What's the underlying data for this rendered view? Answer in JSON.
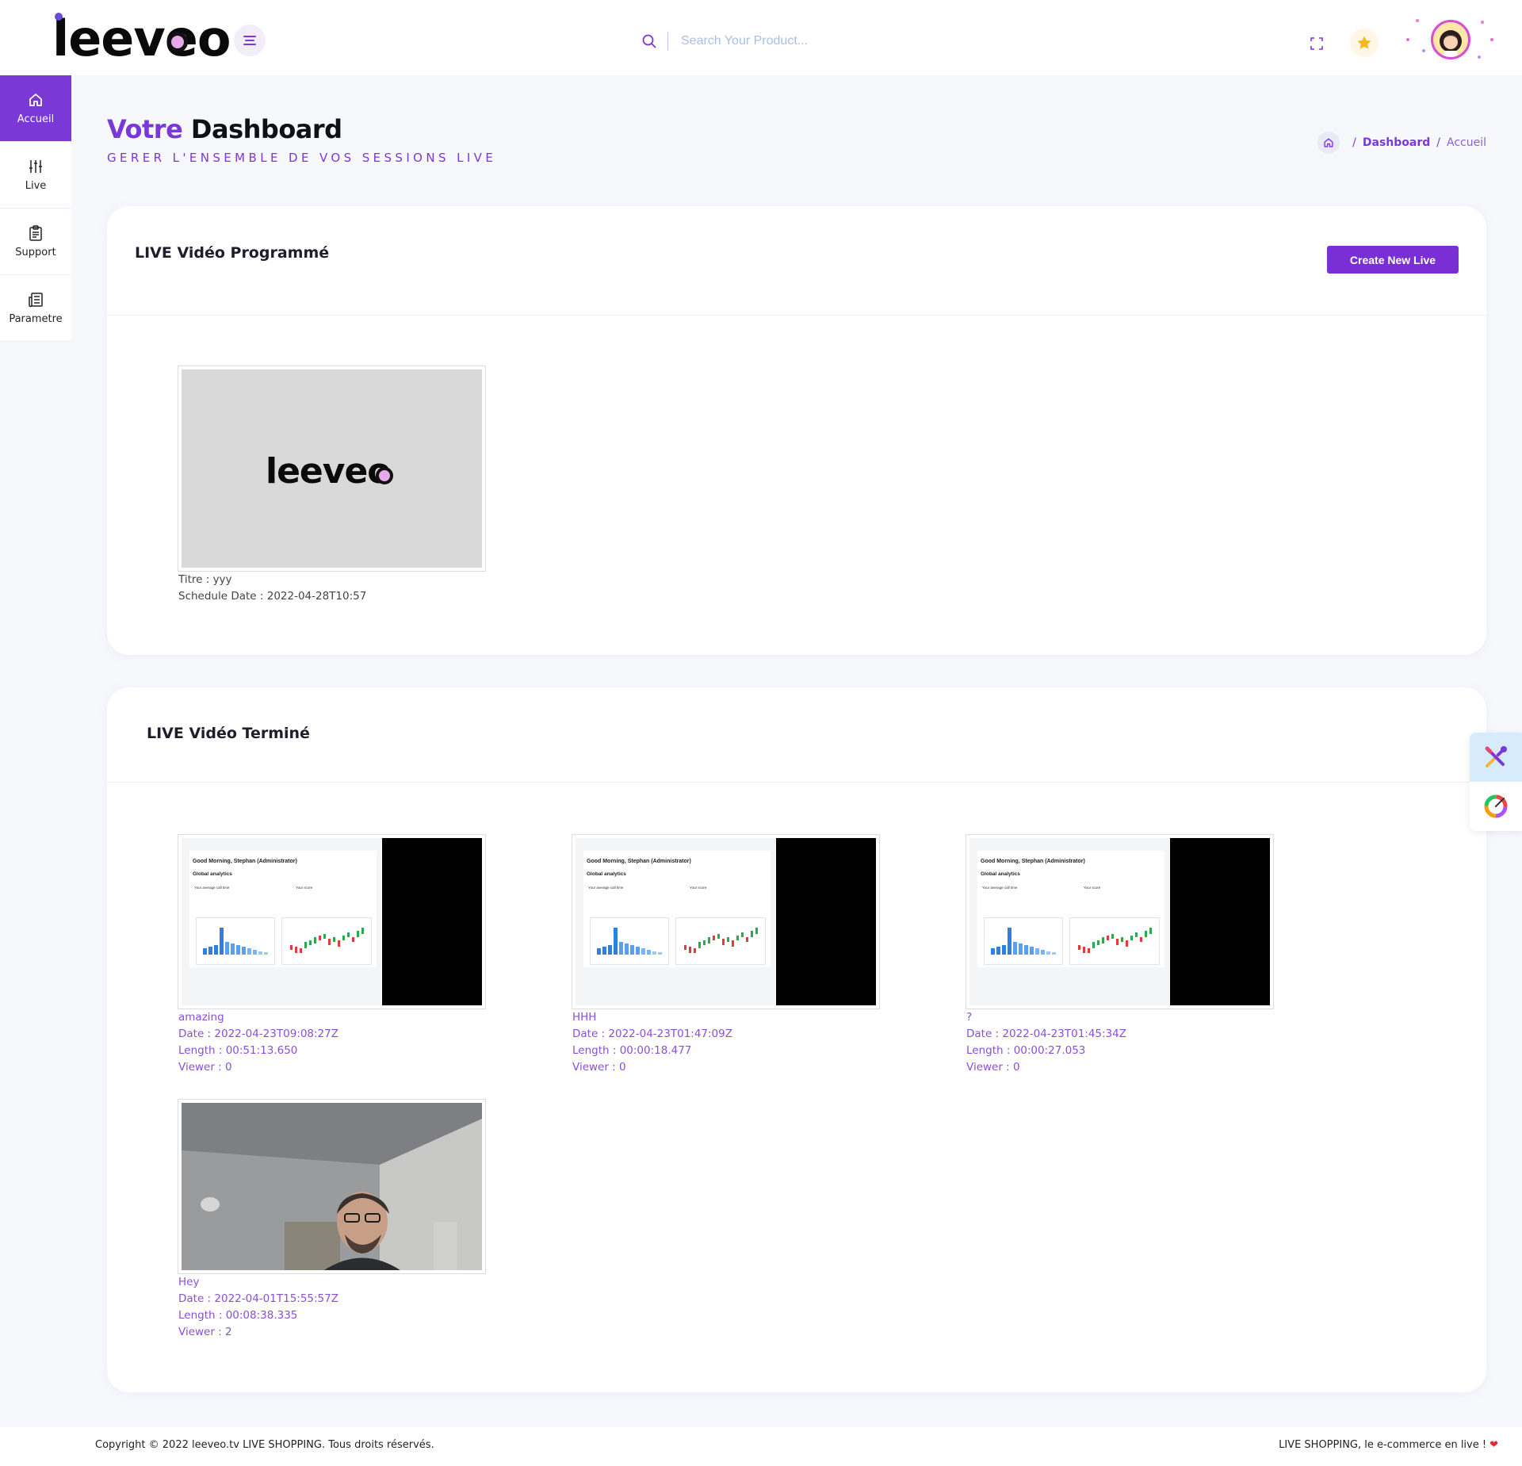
{
  "header": {
    "logo_text": "leeveo",
    "search_placeholder": "Search Your Product..."
  },
  "sidebar": {
    "items": [
      {
        "label": "Accueil",
        "icon": "home-icon",
        "active": true
      },
      {
        "label": "Live",
        "icon": "sliders-icon",
        "active": false
      },
      {
        "label": "Support",
        "icon": "clipboard-icon",
        "active": false
      },
      {
        "label": "Parametre",
        "icon": "newspaper-icon",
        "active": false
      }
    ]
  },
  "page": {
    "title_accent": "Votre",
    "title_rest": "Dashboard",
    "subtitle": "GERER L'ENSEMBLE DE VOS SESSIONS LIVE"
  },
  "breadcrumb": {
    "link": "Dashboard",
    "current": "Accueil",
    "separator": "/"
  },
  "scheduled": {
    "title": "LIVE Vidéo Programmé",
    "create_button": "Create New Live",
    "items": [
      {
        "title_line": "Titre : yyy",
        "date_line": "Schedule Date : 2022-04-28T10:57",
        "thumb_logo": "leeveo"
      }
    ]
  },
  "finished": {
    "title": "LIVE Vidéo Terminé",
    "items": [
      {
        "name": "amazing",
        "date": "Date : 2022-04-23T09:08:27Z",
        "length": "Length : 00:51:13.650",
        "viewer": "Viewer : 0"
      },
      {
        "name": "HHH",
        "date": "Date : 2022-04-23T01:47:09Z",
        "length": "Length : 00:00:18.477",
        "viewer": "Viewer : 0"
      },
      {
        "name": "?",
        "date": "Date : 2022-04-23T01:45:34Z",
        "length": "Length : 00:00:27.053",
        "viewer": "Viewer : 0"
      },
      {
        "name": "Hey",
        "date": "Date : 2022-04-01T15:55:57Z",
        "length": "Length : 00:08:38.335",
        "viewer": "Viewer : 2"
      }
    ],
    "dash_thumb": {
      "greeting": "Good Morning,  Stephan (Administrator)",
      "section": "Global analytics",
      "label_left": "Your average call time",
      "label_right": "Your score"
    }
  },
  "footer": {
    "copyright": "Copyright © 2022 leeveo.tv LIVE SHOPPING. Tous droits réservés.",
    "tagline": "LIVE SHOPPING, le e-commerce en live !",
    "heart": "❤"
  },
  "colors": {
    "brand_purple": "#7a38d6",
    "button_purple": "#7a2fd4",
    "meta_purple": "#8a4fd8",
    "heart_red": "#e02b2b"
  }
}
